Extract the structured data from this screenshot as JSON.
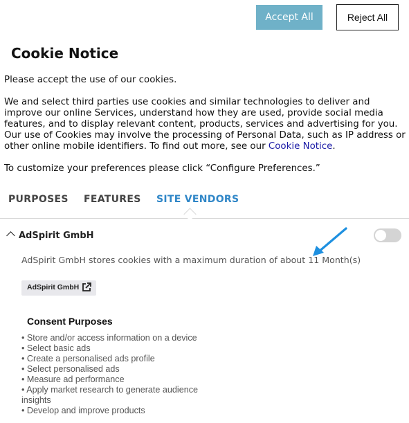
{
  "buttons": {
    "accept_all": "Accept All",
    "reject_all": "Reject All"
  },
  "notice": {
    "title": "Cookie Notice",
    "p1": "Please accept the use of our cookies.",
    "p2_text": "We and select third parties use cookies and similar technologies to deliver and improve our online Services, understand how they are used, provide social media features, and to display relevant content, products, services and advertising for you. Our use of Cookies may involve the processing of Personal Data, such as IP address or other online mobile identifiers. To find out more, see our ",
    "p2_link": "Cookie Notice",
    "p2_end": ".",
    "p3": "To customize your preferences please click “Configure Preferences.”"
  },
  "tabs": [
    {
      "label": "PURPOSES",
      "active": false
    },
    {
      "label": "FEATURES",
      "active": false
    },
    {
      "label": "SITE VENDORS",
      "active": true
    }
  ],
  "vendor": {
    "name": "AdSpirit GmbH",
    "toggle_on": false,
    "description": "AdSpirit GmbH stores cookies with a maximum duration of about 11 Month(s)",
    "link_label": "AdSpirit GmbH"
  },
  "consent_purposes": {
    "title": "Consent Purposes",
    "items": [
      "• Store and/or access information on a device",
      "• Select basic ads",
      "• Create a personalised ads profile",
      "• Select personalised ads",
      "• Measure ad performance",
      "• Apply market research to generate audience insights",
      "• Develop and improve products"
    ]
  },
  "colors": {
    "accept_bg": "#6fb1c8",
    "tab_active": "#2f86c7",
    "link": "#1a1aa6",
    "annotation_arrow": "#1e90e0"
  },
  "icons": [
    "chevron-up-icon",
    "external-link-icon",
    "annotation-arrow-icon"
  ]
}
